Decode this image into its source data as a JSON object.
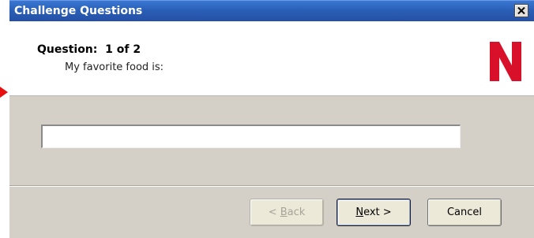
{
  "window": {
    "title": "Challenge Questions",
    "close_glyph": "✕"
  },
  "header": {
    "question_counter": "Question:  1 of 2",
    "question_text": "My favorite food is:",
    "logo_letter": "N",
    "logo_color": "#d9102a"
  },
  "form": {
    "answer_value": "",
    "answer_placeholder": ""
  },
  "buttons": {
    "back": {
      "prefix": "< ",
      "mnemonic": "B",
      "rest": "ack",
      "enabled": false
    },
    "next": {
      "mnemonic": "N",
      "rest": "ext >",
      "is_default": true
    },
    "cancel": {
      "label": "Cancel"
    }
  },
  "colors": {
    "title_bar": "#2a5fb5",
    "dialog_face": "#d4d0c8",
    "pointer_arrow": "#e8100f"
  }
}
